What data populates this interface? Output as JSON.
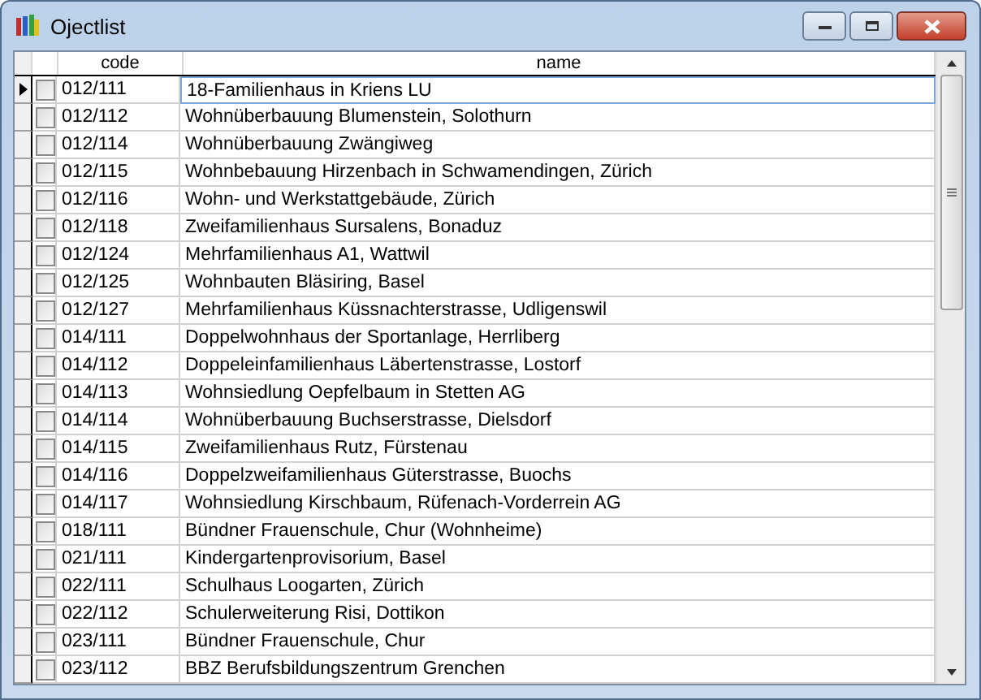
{
  "window": {
    "title": "Ojectlist"
  },
  "table": {
    "columns": [
      "code",
      "name"
    ],
    "rows": [
      {
        "code": "012/111",
        "name": "18-Familienhaus in Kriens LU",
        "checked": false,
        "selected": true
      },
      {
        "code": "012/112",
        "name": "Wohnüberbauung Blumenstein, Solothurn",
        "checked": false,
        "selected": false
      },
      {
        "code": "012/114",
        "name": "Wohnüberbauung Zwängiweg",
        "checked": false,
        "selected": false
      },
      {
        "code": "012/115",
        "name": "Wohnbebauung Hirzenbach in Schwamendingen, Zürich",
        "checked": false,
        "selected": false
      },
      {
        "code": "012/116",
        "name": "Wohn- und Werkstattgebäude, Zürich",
        "checked": false,
        "selected": false
      },
      {
        "code": "012/118",
        "name": "Zweifamilienhaus Sursalens, Bonaduz",
        "checked": false,
        "selected": false
      },
      {
        "code": "012/124",
        "name": "Mehrfamilienhaus A1, Wattwil",
        "checked": false,
        "selected": false
      },
      {
        "code": "012/125",
        "name": "Wohnbauten Bläsiring, Basel",
        "checked": false,
        "selected": false
      },
      {
        "code": "012/127",
        "name": "Mehrfamilienhaus Küssnachterstrasse, Udligenswil",
        "checked": false,
        "selected": false
      },
      {
        "code": "014/111",
        "name": "Doppelwohnhaus der Sportanlage, Herrliberg",
        "checked": false,
        "selected": false
      },
      {
        "code": "014/112",
        "name": "Doppeleinfamilienhaus Läbertenstrasse, Lostorf",
        "checked": false,
        "selected": false
      },
      {
        "code": "014/113",
        "name": "Wohnsiedlung Oepfelbaum in Stetten AG",
        "checked": false,
        "selected": false
      },
      {
        "code": "014/114",
        "name": "Wohnüberbauung Buchserstrasse, Dielsdorf",
        "checked": false,
        "selected": false
      },
      {
        "code": "014/115",
        "name": "Zweifamilienhaus Rutz, Fürstenau",
        "checked": false,
        "selected": false
      },
      {
        "code": "014/116",
        "name": "Doppelzweifamilienhaus Güterstrasse, Buochs",
        "checked": false,
        "selected": false
      },
      {
        "code": "014/117",
        "name": "Wohnsiedlung Kirschbaum, Rüfenach-Vorderrein AG",
        "checked": false,
        "selected": false
      },
      {
        "code": "018/111",
        "name": "Bündner Frauenschule, Chur (Wohnheime)",
        "checked": false,
        "selected": false
      },
      {
        "code": "021/111",
        "name": "Kindergartenprovisorium, Basel",
        "checked": false,
        "selected": false
      },
      {
        "code": "022/111",
        "name": "Schulhaus Loogarten, Zürich",
        "checked": false,
        "selected": false
      },
      {
        "code": "022/112",
        "name": "Schulerweiterung Risi, Dottikon",
        "checked": false,
        "selected": false
      },
      {
        "code": "023/111",
        "name": "Bündner Frauenschule, Chur",
        "checked": false,
        "selected": false
      },
      {
        "code": "023/112",
        "name": "BBZ Berufsbildungszentrum Grenchen",
        "checked": false,
        "selected": false
      }
    ]
  }
}
